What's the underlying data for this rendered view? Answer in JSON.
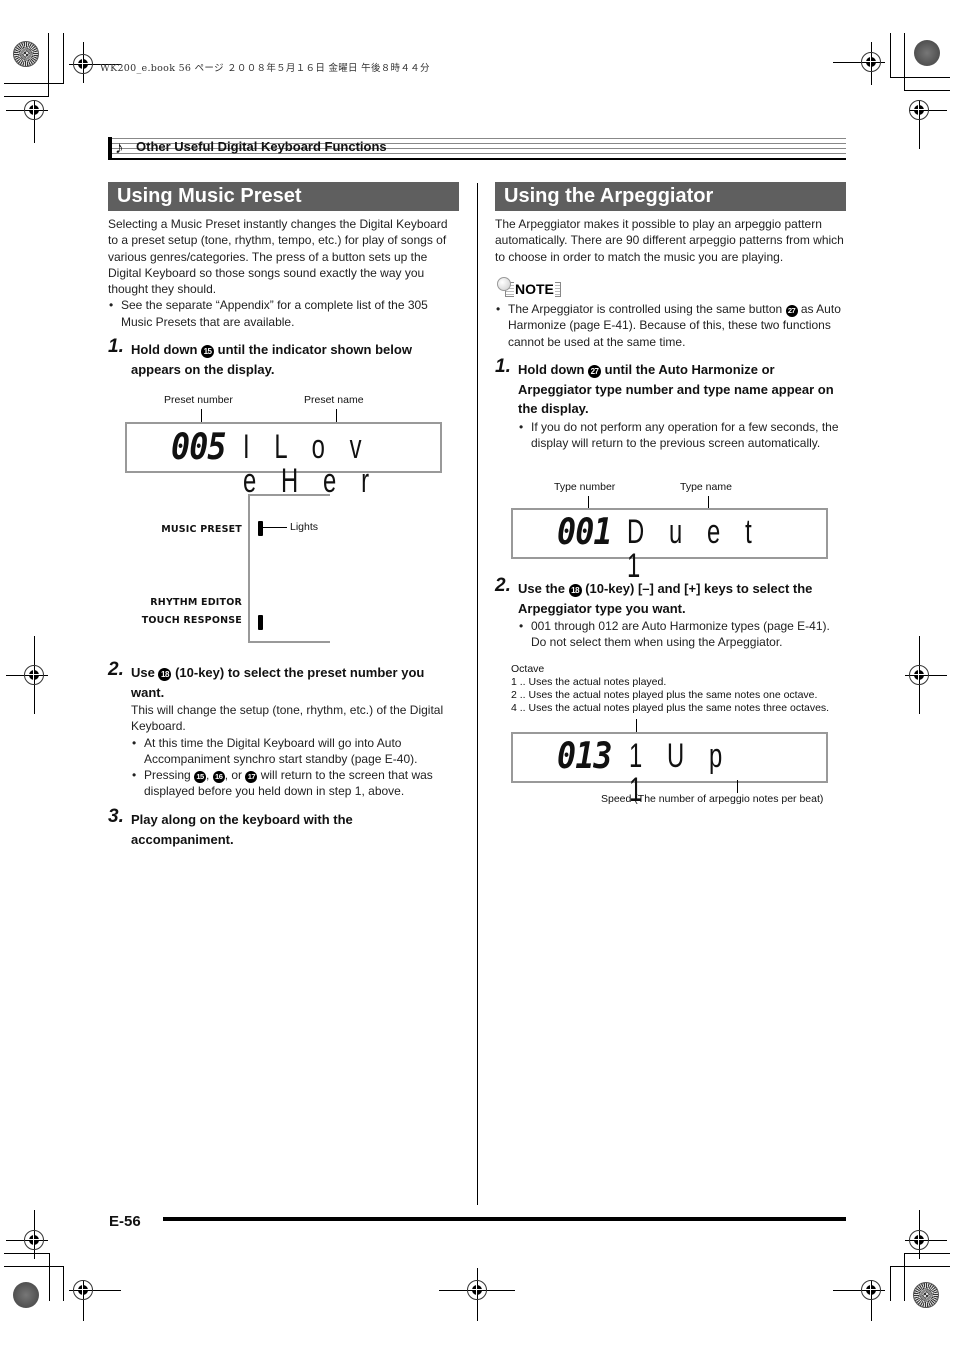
{
  "print_stamp": "WK200_e.book  56 ページ  ２００８年５月１６日  金曜日  午後８時４４分",
  "chapter": {
    "icon": "music-note-icon",
    "title": "Other Useful Digital Keyboard Functions"
  },
  "left": {
    "section_title": "Using Music Preset",
    "intro": "Selecting a Music Preset instantly changes the Digital Keyboard to a preset setup (tone, rhythm, tempo, etc.) for play of songs of various genres/categories. The press of a button sets up the Digital Keyboard so those songs sound exactly the way you thought they should.",
    "intro_bullet": "See the separate “Appendix” for a complete list of the 305 Music Presets that are available.",
    "step1": {
      "num": "1.",
      "pre": "Hold down ",
      "button": "15",
      "post": " until the indicator shown below appears on the display."
    },
    "display1": {
      "label_number": "Preset number",
      "label_name": "Preset name",
      "number": "005",
      "name": "I L o v e H e r"
    },
    "indicator": {
      "music_preset": "MUSIC PRESET",
      "rhythm_editor": "RHYTHM EDITOR",
      "touch_response": "TOUCH RESPONSE",
      "lights_label": "Lights"
    },
    "step2": {
      "num": "2.",
      "pre": "Use ",
      "button": "18",
      "post": " (10-key) to select the preset number you want.",
      "body": "This will change the setup (tone, rhythm, etc.) of the Digital Keyboard.",
      "bullet1": "At this time the Digital Keyboard will go into Auto Accompaniment synchro start standby (page E-40).",
      "bullet2_pre": "Pressing ",
      "bullet2_b1": "15",
      "bullet2_sep1": ", ",
      "bullet2_b2": "16",
      "bullet2_sep2": ", or ",
      "bullet2_b3": "17",
      "bullet2_post": " will return to the screen that was displayed before you held down in step 1, above."
    },
    "step3": {
      "num": "3.",
      "text": "Play along on the keyboard with the accompaniment."
    }
  },
  "right": {
    "section_title": "Using the Arpeggiator",
    "intro": "The Arpeggiator makes it possible to play an arpeggio pattern automatically. There are 90 different arpeggio patterns from which to choose in order to match the music you are playing.",
    "note_label": "NOTE",
    "note_pre": "The Arpeggiator is controlled using the same button ",
    "note_button": "27",
    "note_post": " as Auto Harmonize (page E-41). Because of this, these two functions cannot be used at the same time.",
    "step1": {
      "num": "1.",
      "pre": "Hold down ",
      "button": "27",
      "post": " until the Auto Harmonize or Arpeggiator type number and type name appear on the display.",
      "bullet": "If you do not perform any operation for a few seconds, the display will return to the previous screen automatically."
    },
    "display1": {
      "label_number": "Type number",
      "label_name": "Type name",
      "number": "001",
      "name": "D u e t   1"
    },
    "step2": {
      "num": "2.",
      "pre": "Use the ",
      "button": "18",
      "post": " (10-key) [–] and [+] keys to select the Arpeggiator type you want.",
      "bullet": "001 through 012 are Auto Harmonize types (page E-41). Do not select them when using the Arpeggiator."
    },
    "octave": {
      "title": "Octave",
      "items": [
        "1 .. Uses the actual notes played.",
        "2 .. Uses the actual notes played plus the same notes one octave.",
        "4 .. Uses the actual notes played plus the same notes three octaves."
      ]
    },
    "display2": {
      "number": "013",
      "name": "1 U p   1",
      "speed_label": "Speed (The number of arpeggio notes per beat)"
    }
  },
  "footer": {
    "page_number": "E-56"
  }
}
